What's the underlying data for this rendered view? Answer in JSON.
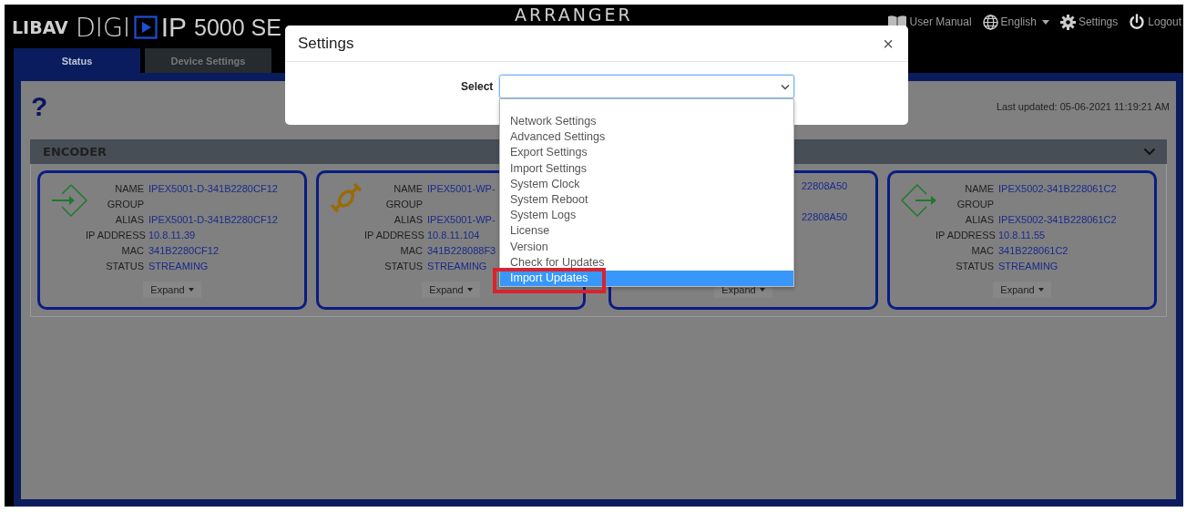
{
  "header": {
    "brand": "LIBAV",
    "product": "DIGI",
    "product_suffix": "IP",
    "series": "5000 SE",
    "app_title": "ARRANGER",
    "links": [
      {
        "kind": "manual",
        "label": "User Manual"
      },
      {
        "kind": "language",
        "label": "English"
      },
      {
        "kind": "settings",
        "label": "Settings"
      },
      {
        "kind": "logout",
        "label": "Logout"
      }
    ]
  },
  "tabs": [
    {
      "label": "Status",
      "selected": true
    },
    {
      "label": "Device Settings",
      "selected": false
    }
  ],
  "status_panel": {
    "help": "?",
    "last_updated": "Last updated: 05-06-2021 11:19:21 AM",
    "section": {
      "title": "ENCODER",
      "expanded": true
    }
  },
  "devices": [
    {
      "kind": "input",
      "fields": [
        {
          "label": "NAME",
          "value": "IPEX5001-D-341B2280CF12"
        },
        {
          "label": "GROUP"
        },
        {
          "label": "ALIAS",
          "value": "IPEX5001-D-341B2280CF12"
        },
        {
          "label": "IP ADDRESS",
          "value": "10.8.11.39"
        },
        {
          "label": "MAC",
          "value": "341B2280CF12"
        },
        {
          "label": "STATUS",
          "value": "STREAMING"
        }
      ],
      "expand_label": "Expand"
    },
    {
      "kind": "plug",
      "fields": [
        {
          "label": "NAME",
          "value": "IPEX5001-WP-"
        },
        {
          "label": "GROUP"
        },
        {
          "label": "ALIAS",
          "value": "IPEX5001-WP-"
        },
        {
          "label": "IP ADDRESS",
          "value": "10.8.11.104"
        },
        {
          "label": "MAC",
          "value": "341B228088F3"
        },
        {
          "label": "STATUS",
          "value": "STREAMING"
        }
      ],
      "expand_label": "Expand"
    },
    {
      "kind": "covered",
      "fields": [
        {
          "value": "22808A50"
        },
        {
          "value": "22808A50"
        }
      ],
      "expand_label": "Expand"
    },
    {
      "kind": "output",
      "fields": [
        {
          "label": "NAME",
          "value": "IPEX5002-341B228061C2"
        },
        {
          "label": "GROUP"
        },
        {
          "label": "ALIAS",
          "value": "IPEX5002-341B228061C2"
        },
        {
          "label": "IP ADDRESS",
          "value": "10.8.11.55"
        },
        {
          "label": "MAC",
          "value": "341B228061C2"
        },
        {
          "label": "STATUS",
          "value": "STREAMING"
        }
      ],
      "expand_label": "Expand"
    }
  ],
  "modal": {
    "title": "Settings",
    "close": "×",
    "select_label": "Select",
    "options": [
      {
        "label": "Network Settings",
        "selected": false
      },
      {
        "label": "Advanced Settings",
        "selected": false
      },
      {
        "label": "Export Settings",
        "selected": false
      },
      {
        "label": "Import Settings",
        "selected": false
      },
      {
        "label": "System Clock",
        "selected": false
      },
      {
        "label": "System Reboot",
        "selected": false
      },
      {
        "label": "System Logs",
        "selected": false
      },
      {
        "label": "License",
        "selected": false
      },
      {
        "label": "Version",
        "selected": false
      },
      {
        "label": "Check for Updates",
        "selected": false
      },
      {
        "label": "Import Updates",
        "selected": true,
        "highlighted": true
      }
    ]
  }
}
